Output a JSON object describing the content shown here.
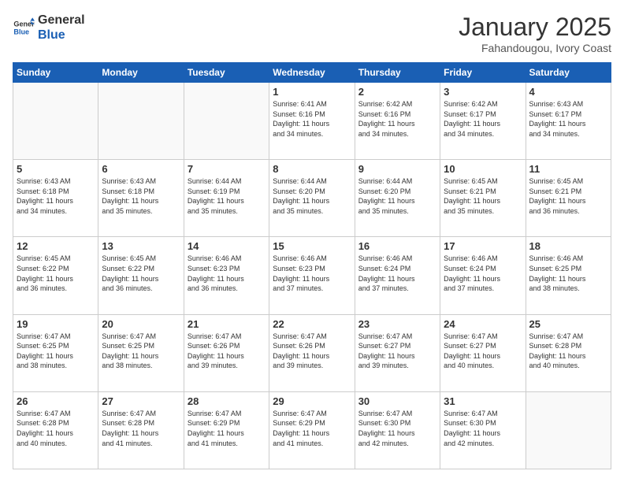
{
  "header": {
    "logo_line1": "General",
    "logo_line2": "Blue",
    "month_title": "January 2025",
    "location": "Fahandougou, Ivory Coast"
  },
  "days_of_week": [
    "Sunday",
    "Monday",
    "Tuesday",
    "Wednesday",
    "Thursday",
    "Friday",
    "Saturday"
  ],
  "weeks": [
    [
      {
        "day": "",
        "info": ""
      },
      {
        "day": "",
        "info": ""
      },
      {
        "day": "",
        "info": ""
      },
      {
        "day": "1",
        "info": "Sunrise: 6:41 AM\nSunset: 6:16 PM\nDaylight: 11 hours\nand 34 minutes."
      },
      {
        "day": "2",
        "info": "Sunrise: 6:42 AM\nSunset: 6:16 PM\nDaylight: 11 hours\nand 34 minutes."
      },
      {
        "day": "3",
        "info": "Sunrise: 6:42 AM\nSunset: 6:17 PM\nDaylight: 11 hours\nand 34 minutes."
      },
      {
        "day": "4",
        "info": "Sunrise: 6:43 AM\nSunset: 6:17 PM\nDaylight: 11 hours\nand 34 minutes."
      }
    ],
    [
      {
        "day": "5",
        "info": "Sunrise: 6:43 AM\nSunset: 6:18 PM\nDaylight: 11 hours\nand 34 minutes."
      },
      {
        "day": "6",
        "info": "Sunrise: 6:43 AM\nSunset: 6:18 PM\nDaylight: 11 hours\nand 35 minutes."
      },
      {
        "day": "7",
        "info": "Sunrise: 6:44 AM\nSunset: 6:19 PM\nDaylight: 11 hours\nand 35 minutes."
      },
      {
        "day": "8",
        "info": "Sunrise: 6:44 AM\nSunset: 6:20 PM\nDaylight: 11 hours\nand 35 minutes."
      },
      {
        "day": "9",
        "info": "Sunrise: 6:44 AM\nSunset: 6:20 PM\nDaylight: 11 hours\nand 35 minutes."
      },
      {
        "day": "10",
        "info": "Sunrise: 6:45 AM\nSunset: 6:21 PM\nDaylight: 11 hours\nand 35 minutes."
      },
      {
        "day": "11",
        "info": "Sunrise: 6:45 AM\nSunset: 6:21 PM\nDaylight: 11 hours\nand 36 minutes."
      }
    ],
    [
      {
        "day": "12",
        "info": "Sunrise: 6:45 AM\nSunset: 6:22 PM\nDaylight: 11 hours\nand 36 minutes."
      },
      {
        "day": "13",
        "info": "Sunrise: 6:45 AM\nSunset: 6:22 PM\nDaylight: 11 hours\nand 36 minutes."
      },
      {
        "day": "14",
        "info": "Sunrise: 6:46 AM\nSunset: 6:23 PM\nDaylight: 11 hours\nand 36 minutes."
      },
      {
        "day": "15",
        "info": "Sunrise: 6:46 AM\nSunset: 6:23 PM\nDaylight: 11 hours\nand 37 minutes."
      },
      {
        "day": "16",
        "info": "Sunrise: 6:46 AM\nSunset: 6:24 PM\nDaylight: 11 hours\nand 37 minutes."
      },
      {
        "day": "17",
        "info": "Sunrise: 6:46 AM\nSunset: 6:24 PM\nDaylight: 11 hours\nand 37 minutes."
      },
      {
        "day": "18",
        "info": "Sunrise: 6:46 AM\nSunset: 6:25 PM\nDaylight: 11 hours\nand 38 minutes."
      }
    ],
    [
      {
        "day": "19",
        "info": "Sunrise: 6:47 AM\nSunset: 6:25 PM\nDaylight: 11 hours\nand 38 minutes."
      },
      {
        "day": "20",
        "info": "Sunrise: 6:47 AM\nSunset: 6:25 PM\nDaylight: 11 hours\nand 38 minutes."
      },
      {
        "day": "21",
        "info": "Sunrise: 6:47 AM\nSunset: 6:26 PM\nDaylight: 11 hours\nand 39 minutes."
      },
      {
        "day": "22",
        "info": "Sunrise: 6:47 AM\nSunset: 6:26 PM\nDaylight: 11 hours\nand 39 minutes."
      },
      {
        "day": "23",
        "info": "Sunrise: 6:47 AM\nSunset: 6:27 PM\nDaylight: 11 hours\nand 39 minutes."
      },
      {
        "day": "24",
        "info": "Sunrise: 6:47 AM\nSunset: 6:27 PM\nDaylight: 11 hours\nand 40 minutes."
      },
      {
        "day": "25",
        "info": "Sunrise: 6:47 AM\nSunset: 6:28 PM\nDaylight: 11 hours\nand 40 minutes."
      }
    ],
    [
      {
        "day": "26",
        "info": "Sunrise: 6:47 AM\nSunset: 6:28 PM\nDaylight: 11 hours\nand 40 minutes."
      },
      {
        "day": "27",
        "info": "Sunrise: 6:47 AM\nSunset: 6:28 PM\nDaylight: 11 hours\nand 41 minutes."
      },
      {
        "day": "28",
        "info": "Sunrise: 6:47 AM\nSunset: 6:29 PM\nDaylight: 11 hours\nand 41 minutes."
      },
      {
        "day": "29",
        "info": "Sunrise: 6:47 AM\nSunset: 6:29 PM\nDaylight: 11 hours\nand 41 minutes."
      },
      {
        "day": "30",
        "info": "Sunrise: 6:47 AM\nSunset: 6:30 PM\nDaylight: 11 hours\nand 42 minutes."
      },
      {
        "day": "31",
        "info": "Sunrise: 6:47 AM\nSunset: 6:30 PM\nDaylight: 11 hours\nand 42 minutes."
      },
      {
        "day": "",
        "info": ""
      }
    ]
  ]
}
